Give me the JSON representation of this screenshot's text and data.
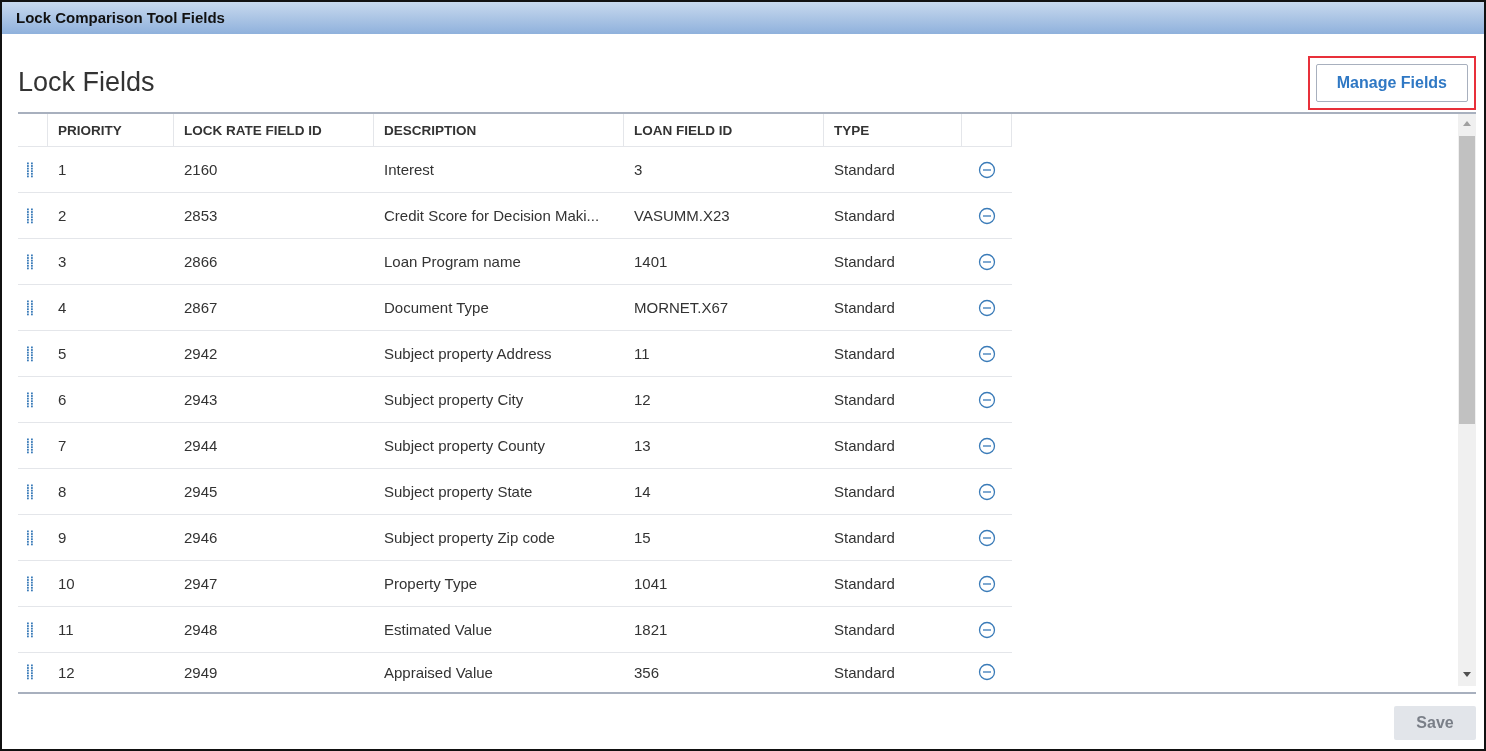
{
  "window": {
    "title": "Lock Comparison Tool Fields"
  },
  "heading": "Lock Fields",
  "manage_button": {
    "label": "Manage Fields",
    "highlighted": true
  },
  "table": {
    "columns": [
      "PRIORITY",
      "LOCK RATE FIELD ID",
      "DESCRIPTION",
      "LOAN FIELD ID",
      "TYPE"
    ],
    "rows": [
      {
        "priority": "1",
        "lock_rate_field_id": "2160",
        "description": "Interest",
        "loan_field_id": "3",
        "type": "Standard"
      },
      {
        "priority": "2",
        "lock_rate_field_id": "2853",
        "description": "Credit Score for Decision Maki...",
        "loan_field_id": "VASUMM.X23",
        "type": "Standard"
      },
      {
        "priority": "3",
        "lock_rate_field_id": "2866",
        "description": "Loan Program name",
        "loan_field_id": "1401",
        "type": "Standard"
      },
      {
        "priority": "4",
        "lock_rate_field_id": "2867",
        "description": "Document Type",
        "loan_field_id": "MORNET.X67",
        "type": "Standard"
      },
      {
        "priority": "5",
        "lock_rate_field_id": "2942",
        "description": "Subject property Address",
        "loan_field_id": "11",
        "type": "Standard"
      },
      {
        "priority": "6",
        "lock_rate_field_id": "2943",
        "description": "Subject property City",
        "loan_field_id": "12",
        "type": "Standard"
      },
      {
        "priority": "7",
        "lock_rate_field_id": "2944",
        "description": "Subject property County",
        "loan_field_id": "13",
        "type": "Standard"
      },
      {
        "priority": "8",
        "lock_rate_field_id": "2945",
        "description": "Subject property State",
        "loan_field_id": "14",
        "type": "Standard"
      },
      {
        "priority": "9",
        "lock_rate_field_id": "2946",
        "description": "Subject property Zip code",
        "loan_field_id": "15",
        "type": "Standard"
      },
      {
        "priority": "10",
        "lock_rate_field_id": "2947",
        "description": "Property Type",
        "loan_field_id": "1041",
        "type": "Standard"
      },
      {
        "priority": "11",
        "lock_rate_field_id": "2948",
        "description": "Estimated Value",
        "loan_field_id": "1821",
        "type": "Standard"
      },
      {
        "priority": "12",
        "lock_rate_field_id": "2949",
        "description": "Appraised Value",
        "loan_field_id": "356",
        "type": "Standard"
      }
    ]
  },
  "save_button": {
    "label": "Save",
    "disabled": true
  }
}
